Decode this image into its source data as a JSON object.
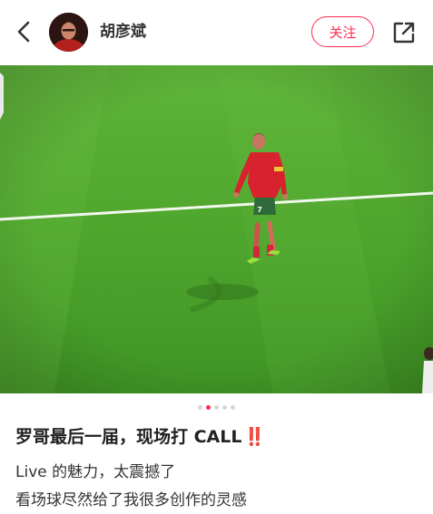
{
  "header": {
    "author_name": "胡彦斌",
    "follow_label": "关注"
  },
  "carousel": {
    "total": 5,
    "active_index": 1,
    "accent_color": "#ff2b4f",
    "player_number": "7"
  },
  "post": {
    "title": "罗哥最后一届，现场打 CALL",
    "title_emoji": "‼️",
    "lines": [
      "Live 的魅力，太震撼了",
      "看场球尽然给了我很多创作的灵感"
    ]
  }
}
